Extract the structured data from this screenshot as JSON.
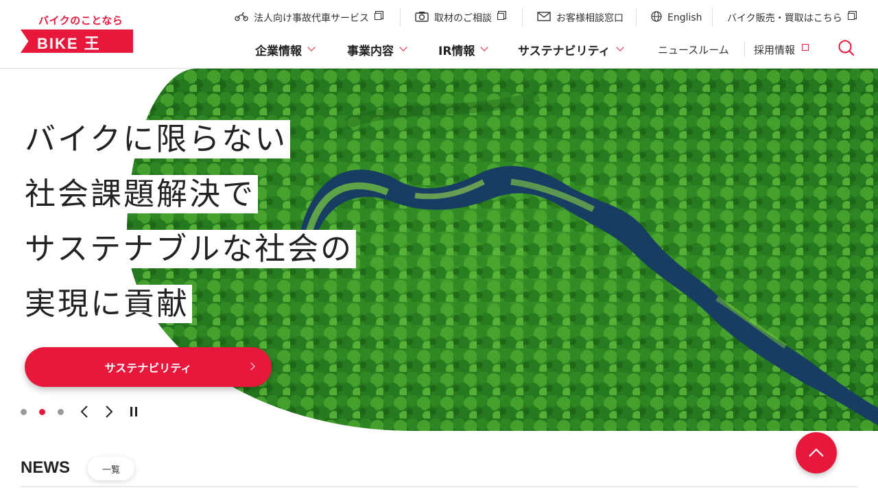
{
  "logo": {
    "tagline": "バイクのことなら",
    "name": "BIKE 王"
  },
  "utility_nav": [
    {
      "label": "法人向け事故代車サービス",
      "icon": "motorbike-icon"
    },
    {
      "label": "取材のご相談",
      "icon": "camera-icon"
    },
    {
      "label": "お客様相談窓口",
      "icon": "mail-icon"
    },
    {
      "label": "English",
      "icon": "globe-icon"
    },
    {
      "label": "バイク販売・買取はこちら",
      "icon": "external-link-icon"
    }
  ],
  "global_nav": [
    {
      "label": "企業情報"
    },
    {
      "label": "事業内容"
    },
    {
      "label": "IR情報"
    },
    {
      "label": "サステナビリティ"
    },
    {
      "label": "ニュースルーム"
    },
    {
      "label": "採用情報"
    }
  ],
  "hero": {
    "lines": [
      "バイクに限らない",
      "社会課題解決で",
      "サステナブルな社会の",
      "実現に貢献"
    ],
    "cta_label": "サステナビリティ",
    "slide_count": 3,
    "active_slide": 2
  },
  "news": {
    "title": "NEWS",
    "all_label": "一覧"
  },
  "colors": {
    "brand_red": "#e8173c"
  }
}
